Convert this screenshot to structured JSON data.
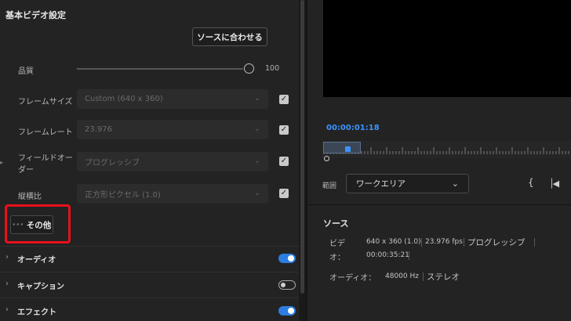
{
  "left_panel": {
    "section_title": "基本ビデオ設定",
    "match_source_label": "ソースに合わせる",
    "quality": {
      "label": "品質",
      "value": "100"
    },
    "frame_size": {
      "label": "フレームサイズ",
      "value": "Custom (640 x 360)"
    },
    "frame_rate": {
      "label": "フレームレート",
      "value": "23.976"
    },
    "field_order": {
      "label_line1": "フィールドオー",
      "label_line2": "ダー",
      "value": "プログレッシブ"
    },
    "aspect": {
      "label": "縦横比",
      "value": "正方形ピクセル (1.0)"
    },
    "more_label": "その他",
    "accordions": [
      {
        "label": "オーディオ",
        "enabled": true
      },
      {
        "label": "キャプション",
        "enabled": false
      },
      {
        "label": "エフェクト",
        "enabled": true
      }
    ]
  },
  "right_panel": {
    "timecode": "00:00:01:18",
    "range_label": "範囲",
    "range_value": "ワークエリア",
    "source_title": "ソース",
    "video_label_line1": "ビデ",
    "video_label_line2": "オ：",
    "video_res": "640 x 360 (1.0)",
    "video_fps": "23.976 fps",
    "video_scan": "プログレッシブ",
    "video_duration": "00:00:35:21",
    "audio_label": "オーディオ：",
    "audio_rate": "48000 Hz",
    "audio_channels": "ステレオ"
  },
  "colors": {
    "accent": "#3b93ff",
    "highlight": "#e8101d",
    "toggle_on": "#2d7ee0"
  },
  "icons": [
    "chevron-down-icon",
    "checkbox-checked-icon",
    "chevron-right-icon",
    "brace-icon",
    "step-back-icon",
    "more-dots-icon"
  ]
}
